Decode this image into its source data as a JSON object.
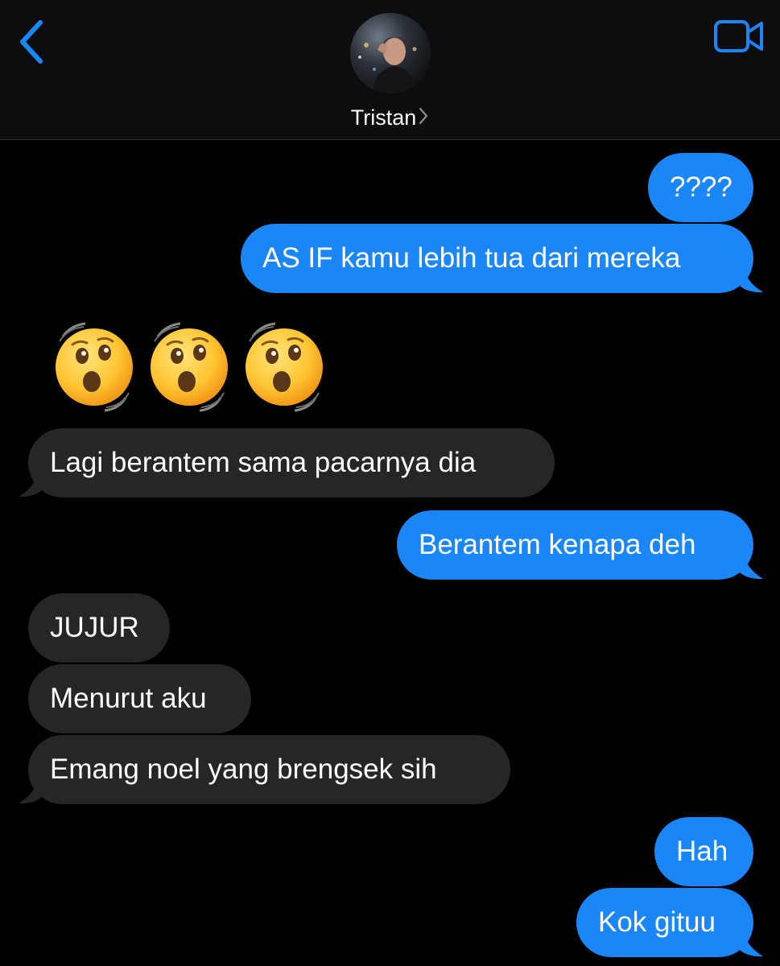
{
  "header": {
    "contact_name": "Tristan",
    "back_icon": "chevron-left-icon",
    "video_icon": "video-camera-icon",
    "accent": "#1b86f8"
  },
  "messages": [
    {
      "from": "me",
      "text": "????"
    },
    {
      "from": "me",
      "text": "AS IF kamu lebih tua dari mereka"
    },
    {
      "from": "them",
      "text": "😲😲😲",
      "emoji_name": "hushed-face-icon"
    },
    {
      "from": "them",
      "text": "Lagi berantem sama pacarnya dia"
    },
    {
      "from": "me",
      "text": "Berantem kenapa deh"
    },
    {
      "from": "them",
      "text": "JUJUR"
    },
    {
      "from": "them",
      "text": "Menurut aku"
    },
    {
      "from": "them",
      "text": "Emang noel yang brengsek sih"
    },
    {
      "from": "me",
      "text": "Hah"
    },
    {
      "from": "me",
      "text": "Kok gituu"
    }
  ],
  "colors": {
    "sent_bubble": "#1b86f8",
    "received_bubble": "#262628",
    "background": "#000000"
  }
}
